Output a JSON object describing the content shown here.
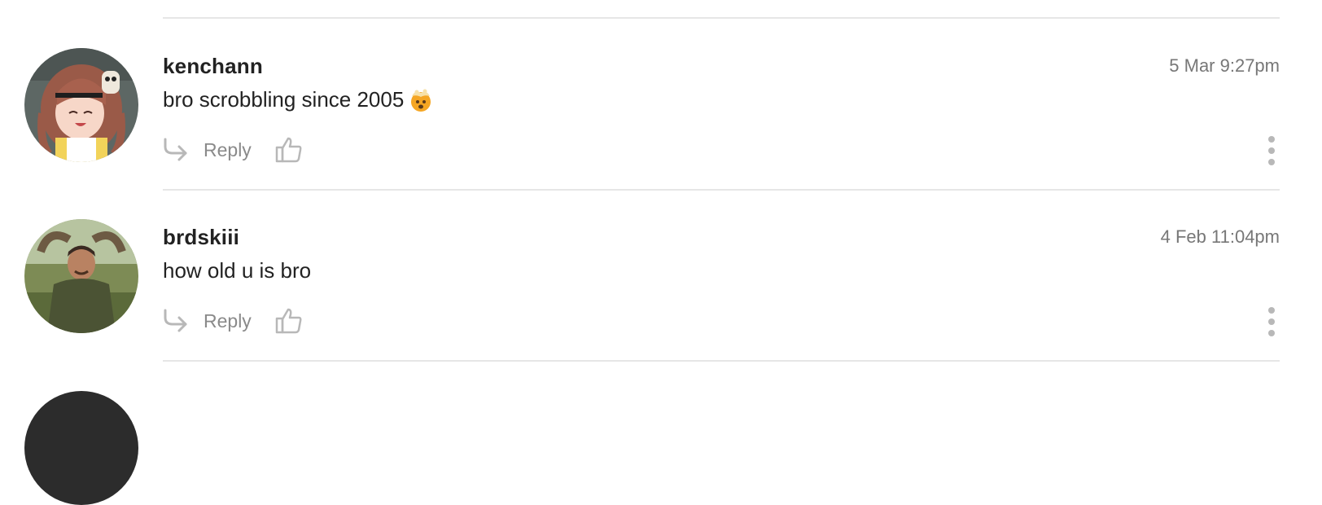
{
  "comments": [
    {
      "username": "kenchann",
      "timestamp": "5 Mar 9:27pm",
      "text": "bro scrobbling since 2005",
      "emoji": "exploding-head-emoji",
      "reply_label": "Reply",
      "avatar": "anime-girl-avatar"
    },
    {
      "username": "brdskiii",
      "timestamp": "4 Feb 11:04pm",
      "text": "how old u is bro",
      "reply_label": "Reply",
      "avatar": "man-photo-avatar"
    }
  ],
  "icons": {
    "reply": "reply-arrow-icon",
    "like": "thumbs-up-icon",
    "more": "more-vertical-icon"
  },
  "colors": {
    "text": "#222222",
    "muted": "#777777",
    "icon": "#b8b8b8",
    "divider": "#e6e6e6"
  }
}
